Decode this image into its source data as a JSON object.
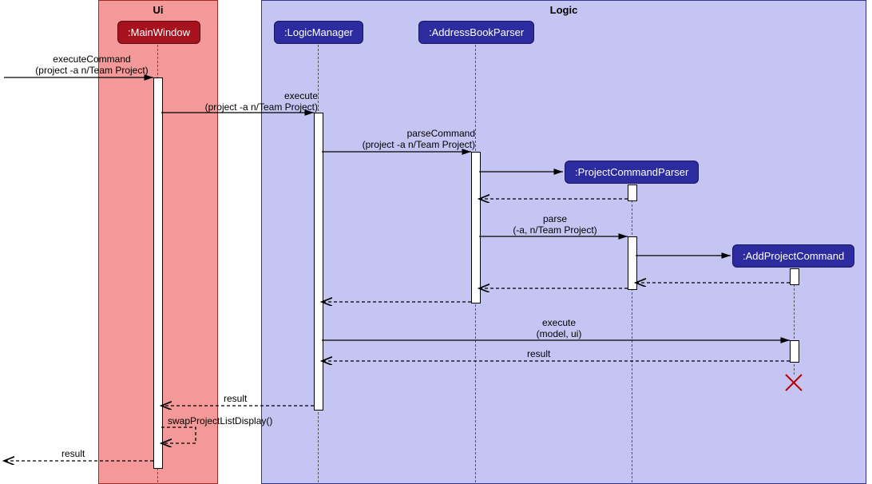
{
  "frames": {
    "ui": {
      "label": "Ui"
    },
    "logic": {
      "label": "Logic"
    }
  },
  "participants": {
    "mainwindow": ":MainWindow",
    "logicmanager": ":LogicManager",
    "addressbookparser": ":AddressBookParser",
    "projectcommandparser": ":ProjectCommandParser",
    "addprojectcommand": ":AddProjectCommand"
  },
  "messages": {
    "m1_line1": "executeCommand",
    "m1_line2": "(project -a n/Team Project)",
    "m2_line1": "execute",
    "m2_line2": "(project -a n/Team Project)",
    "m3_line1": "parseCommand",
    "m3_line2": "(project -a n/Team Project)",
    "m5_line1": "parse",
    "m5_line2": "(-a, n/Team Project)",
    "m8_line1": "execute",
    "m8_line2": "(model, ui)",
    "r1": "result",
    "r2": "result",
    "r3": "result",
    "self1": "swapProjectListDisplay()"
  }
}
